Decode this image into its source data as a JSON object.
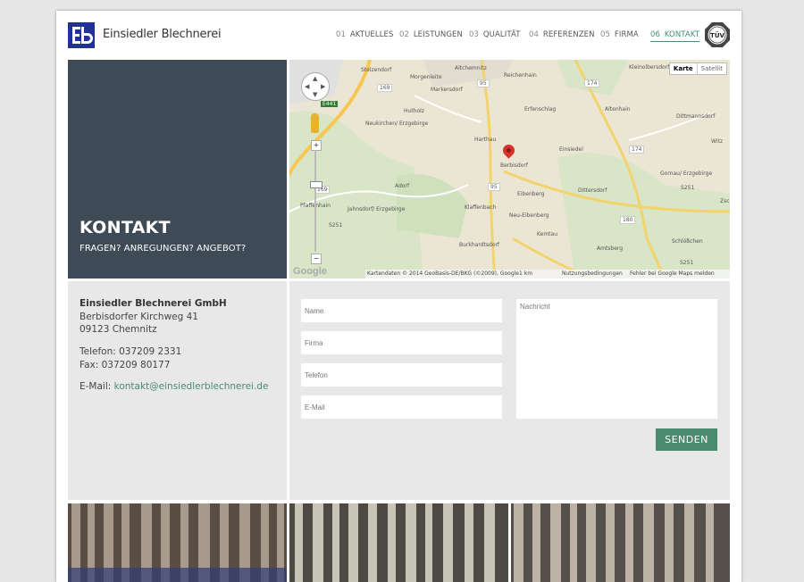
{
  "brand": {
    "name": "Einsiedler Blechnerei",
    "logo_icon": "eb-logo-icon",
    "logo_color": "#22309a"
  },
  "nav": [
    {
      "num": "01",
      "label": "AKTUELLES",
      "active": false
    },
    {
      "num": "02",
      "label": "LEISTUNGEN",
      "active": false
    },
    {
      "num": "03",
      "label": "QUALITÄT",
      "active": false
    },
    {
      "num": "04",
      "label": "REFERENZEN",
      "active": false
    },
    {
      "num": "05",
      "label": "FIRMA",
      "active": false
    },
    {
      "num": "06",
      "label": "KONTAKT",
      "active": true
    }
  ],
  "badge": {
    "text": "TÜV"
  },
  "hero": {
    "title": "KONTAKT",
    "subtitle": "FRAGEN? ANREGUNGEN? ANGEBOT?"
  },
  "map": {
    "toggle": {
      "map": "Karte",
      "satellite": "Satellit"
    },
    "places": [
      "Stelzendorf",
      "Altchemnitz",
      "Kleinolbersdorf",
      "Morgenleite",
      "Reichenhain",
      "Markersdorf",
      "Hutholz",
      "Erfenschlag",
      "Altenhain",
      "Dittmannsdorf",
      "Neukirchen/ Erzgebirge",
      "Harthau",
      "Einsiedel",
      "Berbisdorf",
      "Adorf",
      "Eibenberg",
      "Dittersdorf",
      "Gornau/ Erzgebirge",
      "Klaffenbach",
      "Neu-Eibenberg",
      "Jahnsdorf/ Erzgebirge",
      "Pfaffenhain",
      "Kemtau",
      "Burkhardtsdorf",
      "Amtsberg",
      "Schlößchen",
      "Witz",
      "Zsc"
    ],
    "roads": [
      "95",
      "169",
      "174",
      "180",
      "E441",
      "S251",
      "S237",
      "S236",
      "S255",
      "72"
    ],
    "footer": {
      "attribution": "Kartendaten © 2014 GeoBasis-DE/BKG (©2009), Google",
      "scale": "1 km",
      "terms": "Nutzungsbedingungen",
      "report": "Fehler bei Google Maps melden"
    },
    "google": "Google"
  },
  "contact": {
    "company": "Einsiedler Blechnerei GmbH",
    "street": "Berbisdorfer Kirchweg 41",
    "city": "09123 Chemnitz",
    "phone": "Telefon: 037209 2331",
    "fax": "Fax: 037209 80177",
    "email_label": "E-Mail:",
    "email": "kontakt@einsiedlerblechnerei.de"
  },
  "form": {
    "name_placeholder": "Name",
    "company_placeholder": "Firma",
    "phone_placeholder": "Telefon",
    "email_placeholder": "E-Mail",
    "message_placeholder": "Nachricht",
    "submit": "SENDEN"
  },
  "colors": {
    "accent": "#4b8a6e",
    "hero_bg": "#3f4a57",
    "panel_bg": "#e8e8e8"
  }
}
